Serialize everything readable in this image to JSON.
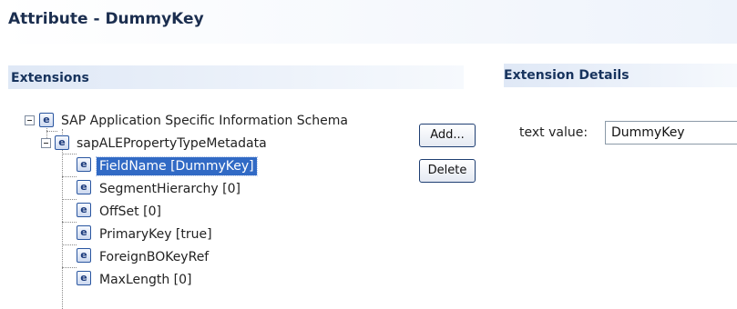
{
  "editor": {
    "title": "Attribute - DummyKey"
  },
  "extensions": {
    "section_title": "Extensions",
    "tree": {
      "root": {
        "label": "SAP Application Specific Information Schema",
        "icon": "e-element-icon"
      },
      "child": {
        "label": "sapALEPropertyTypeMetadata",
        "icon": "e-element-icon"
      },
      "leaves": [
        {
          "label": "FieldName [DummyKey]",
          "selected": true
        },
        {
          "label": "SegmentHierarchy [0]",
          "selected": false
        },
        {
          "label": "OffSet [0]",
          "selected": false
        },
        {
          "label": "PrimaryKey [true]",
          "selected": false
        },
        {
          "label": "ForeignBOKeyRef",
          "selected": false
        },
        {
          "label": "MaxLength [0]",
          "selected": false
        }
      ]
    },
    "buttons": {
      "add": "Add...",
      "delete": "Delete"
    }
  },
  "details": {
    "section_title": "Extension Details",
    "text_value_label": "text value:",
    "text_value": "DummyKey"
  },
  "colors": {
    "selection": "#316ac5",
    "title": "#1b2e4f",
    "section_title": "#17335d"
  }
}
